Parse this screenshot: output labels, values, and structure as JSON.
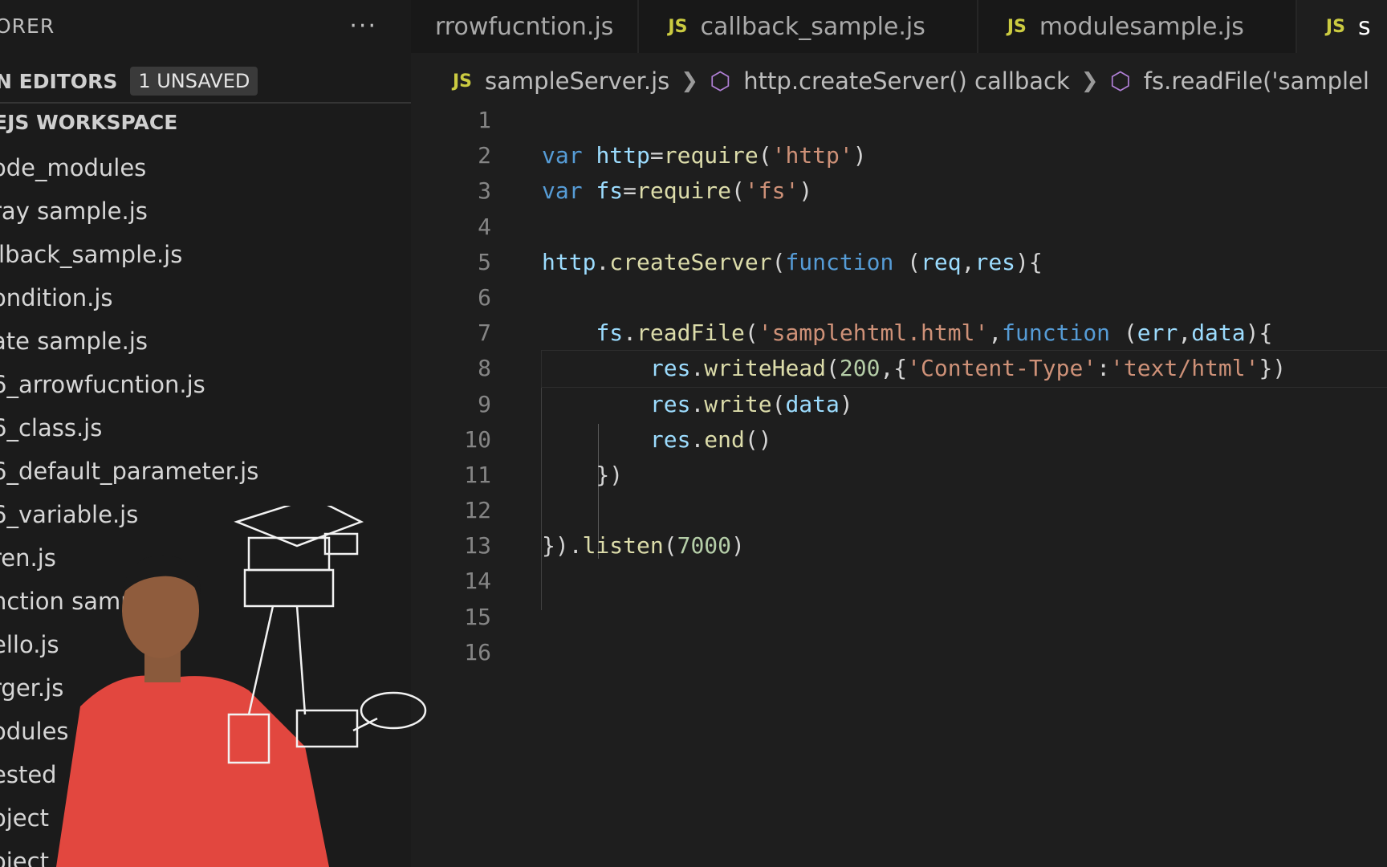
{
  "sidebar": {
    "title": "ORER",
    "more_icon": "ellipsis-icon",
    "open_editors_label": "N EDITORS",
    "unsaved_badge": "1 UNSAVED",
    "workspace_label": "EJS WORKSPACE",
    "files": [
      "ode_modules",
      "ray sample.js",
      "llback_sample.js",
      "ondition.js",
      "ate sample.js",
      "6_arrowfucntion.js",
      "6_class.js",
      "6_default_parameter.js",
      "6_variable.js",
      "ren.js",
      "nction sample.js",
      "ello.js",
      "rger.js",
      "odules",
      "ested",
      "oject",
      "oject"
    ]
  },
  "tabs": [
    {
      "label": "rrowfucntion.js",
      "icon": "",
      "active": false
    },
    {
      "label": "callback_sample.js",
      "icon": "JS",
      "active": false
    },
    {
      "label": "modulesample.js",
      "icon": "JS",
      "active": false
    },
    {
      "label": "s",
      "icon": "JS",
      "active": true
    }
  ],
  "breadcrumb": {
    "file_icon": "JS",
    "file": "sampleServer.js",
    "item1": "http.createServer() callback",
    "item2": "fs.readFile('samplel",
    "symbol_icon": "cube-icon"
  },
  "editor": {
    "line_numbers": [
      "1",
      "2",
      "3",
      "4",
      "5",
      "6",
      "7",
      "8",
      "9",
      "10",
      "11",
      "12",
      "13",
      "14",
      "15",
      "16"
    ],
    "current_line": 8
  },
  "colors": {
    "keyword": "#569cd6",
    "variable": "#9cdcfe",
    "function": "#dcdcaa",
    "string": "#ce9178",
    "number": "#b5cea8",
    "js_icon": "#cbcb41"
  }
}
